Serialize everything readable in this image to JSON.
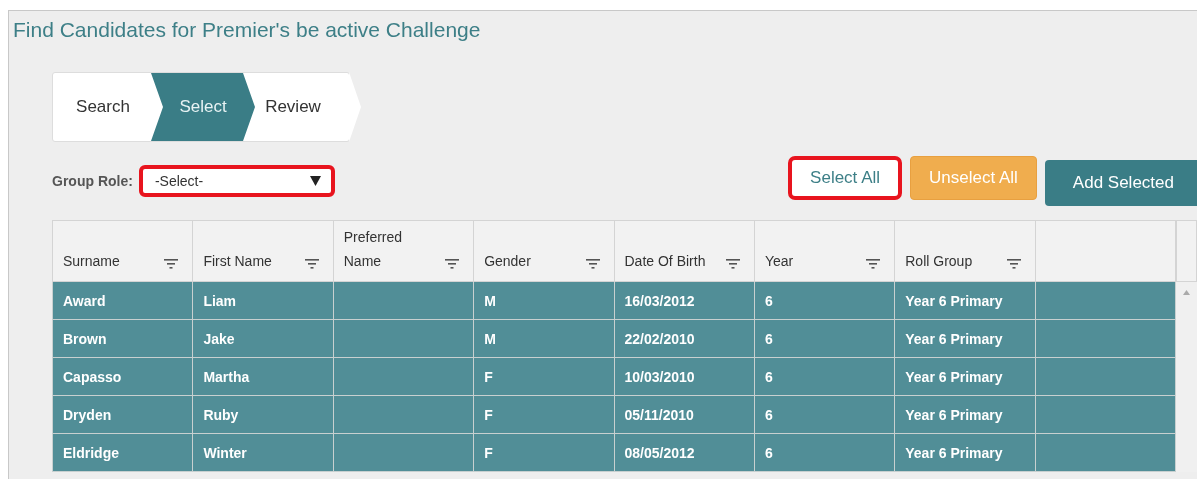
{
  "title": "Find Candidates for Premier's be active Challenge",
  "steps": [
    {
      "label": "Search",
      "selected": false
    },
    {
      "label": "Select",
      "selected": true
    },
    {
      "label": "Review",
      "selected": false
    }
  ],
  "group_role": {
    "label": "Group Role:",
    "value": "-Select-",
    "highlighted": true
  },
  "buttons": [
    {
      "label": "Select All",
      "kind": "plain",
      "highlighted": true
    },
    {
      "label": "Unselect All",
      "kind": "warning",
      "highlighted": false
    },
    {
      "label": "Add Selected",
      "kind": "primary",
      "highlighted": false
    }
  ],
  "table": {
    "columns": [
      {
        "label": "Surname",
        "filter": true
      },
      {
        "label": "First Name",
        "filter": true
      },
      {
        "label": "Preferred Name",
        "filter": true
      },
      {
        "label": "Gender",
        "filter": true
      },
      {
        "label": "Date Of Birth",
        "filter": true
      },
      {
        "label": "Year",
        "filter": true
      },
      {
        "label": "Roll Group",
        "filter": true
      },
      {
        "filter": false
      }
    ],
    "rows": [
      {
        "selected": true,
        "cells": [
          "Award",
          "Liam",
          "",
          "M",
          "16/03/2012",
          "6",
          "Year 6 Primary",
          ""
        ]
      },
      {
        "selected": true,
        "cells": [
          "Brown",
          "Jake",
          "",
          "M",
          "22/02/2010",
          "6",
          "Year 6 Primary",
          ""
        ]
      },
      {
        "selected": true,
        "cells": [
          "Capasso",
          "Martha",
          "",
          "F",
          "10/03/2010",
          "6",
          "Year 6 Primary",
          ""
        ]
      },
      {
        "selected": true,
        "cells": [
          "Dryden",
          "Ruby",
          "",
          "F",
          "05/11/2010",
          "6",
          "Year 6 Primary",
          ""
        ]
      },
      {
        "selected": true,
        "cells": [
          "Eldridge",
          "Winter",
          "",
          "F",
          "08/05/2012",
          "6",
          "Year 6 Primary",
          ""
        ]
      }
    ]
  }
}
